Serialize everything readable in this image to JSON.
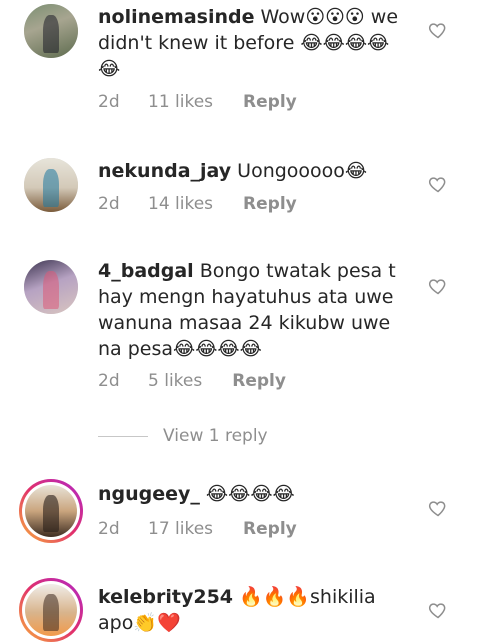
{
  "comments": [
    {
      "username": "nolinemasinde",
      "text": "Wow😮😮😮 we didn't knew it before 😂😂😂😂😂",
      "time": "2d",
      "likes": "11 likes",
      "reply": "Reply"
    },
    {
      "username": "nekunda_jay",
      "text": "Uongooooo😂",
      "time": "2d",
      "likes": "14 likes",
      "reply": "Reply"
    },
    {
      "username": "4_badgal",
      "text": "Bongo twatak pesa t hay mengn hayatuhus ata uwe wanuna masaa 24 kikubw uwe na pesa😂😂😂😂",
      "time": "2d",
      "likes": "5 likes",
      "reply": "Reply"
    },
    {
      "username": "ngugeey_",
      "text": "😂😂😂😂",
      "time": "2d",
      "likes": "17 likes",
      "reply": "Reply"
    },
    {
      "username": "kelebrity254",
      "text": "🔥🔥🔥shikilia apo👏❤️",
      "time": "",
      "likes": "",
      "reply": ""
    }
  ],
  "view_replies": "View 1 reply",
  "icons": {
    "like": "heart-outline-icon"
  },
  "colors": {
    "meta": "#8e8e8e",
    "story_ring_start": "#f9b43a",
    "story_ring_end": "#b026c9"
  }
}
